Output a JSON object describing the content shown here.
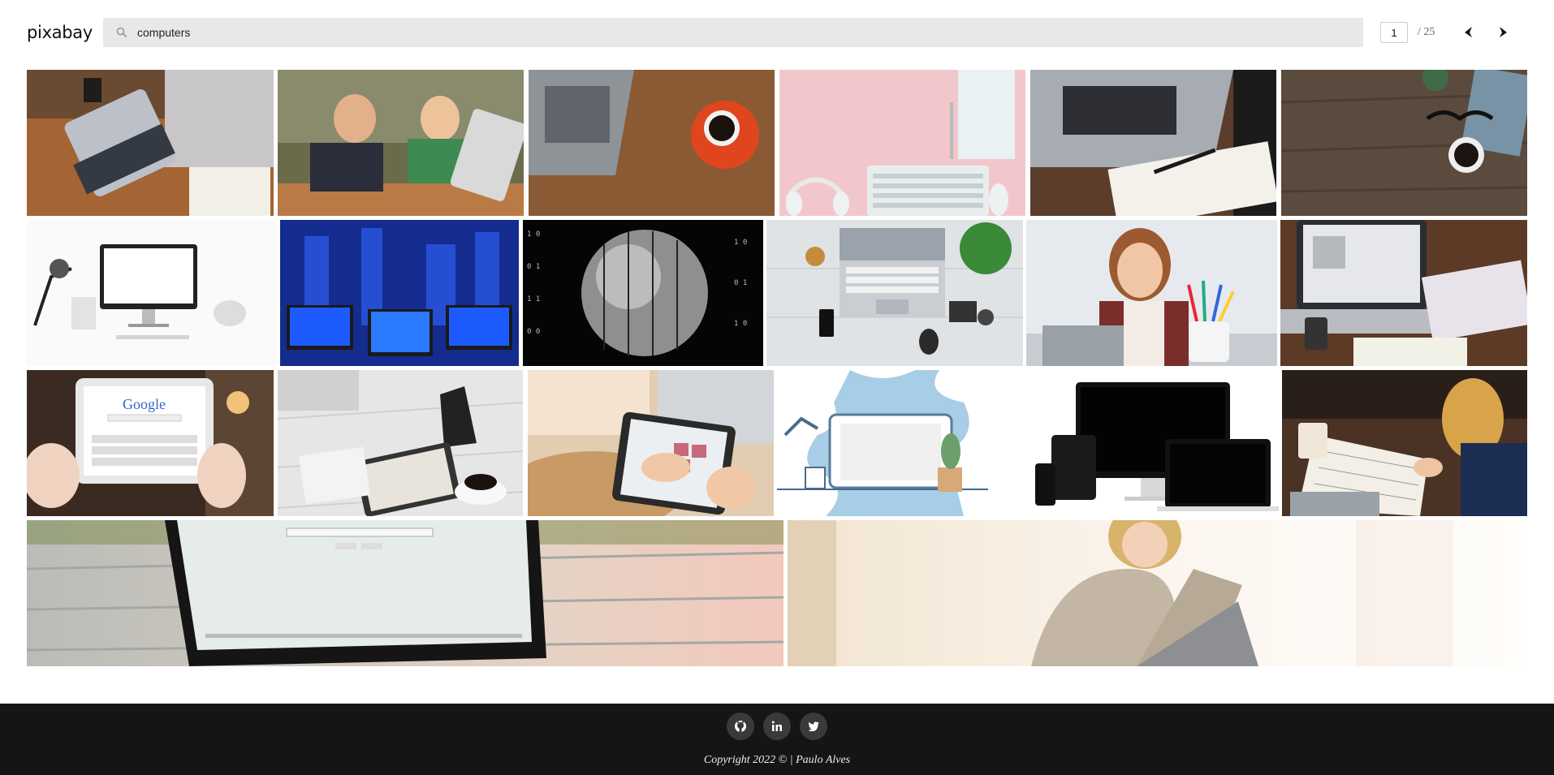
{
  "header": {
    "logo": "pixabay",
    "search": {
      "value": "computers",
      "icon": "search-icon"
    },
    "pager": {
      "current": "1",
      "total": "/ 25",
      "prev_icon": "chevron-left-icon",
      "next_icon": "chevron-right-icon"
    }
  },
  "gallery": {
    "rows": [
      {
        "images": [
          {
            "subject": "laptop-typing-icon"
          },
          {
            "subject": "kids-laptop-icon"
          },
          {
            "subject": "laptop-coffee-icon"
          },
          {
            "subject": "keyboard-headphones-icon"
          },
          {
            "subject": "laptop-notebook-icon"
          },
          {
            "subject": "desk-glasses-icon"
          }
        ]
      },
      {
        "images": [
          {
            "subject": "imac-desk-icon"
          },
          {
            "subject": "blue-monitors-icon"
          },
          {
            "subject": "binary-sphere-icon"
          },
          {
            "subject": "laptop-flatlay-icon"
          },
          {
            "subject": "woman-pencil-icon"
          },
          {
            "subject": "laptop-hands-icon"
          }
        ]
      },
      {
        "images": [
          {
            "subject": "tablet-google-icon"
          },
          {
            "subject": "tablet-coffee-icon"
          },
          {
            "subject": "tablet-hands-icon"
          },
          {
            "subject": "laptop-illustration-icon"
          },
          {
            "subject": "devices-icon"
          },
          {
            "subject": "notebook-people-icon"
          }
        ]
      },
      {
        "images": [
          {
            "subject": "macbook-search-icon"
          },
          {
            "subject": "woman-laptop-icon"
          }
        ]
      }
    ]
  },
  "footer": {
    "social": [
      {
        "name": "github-icon"
      },
      {
        "name": "linkedin-icon"
      },
      {
        "name": "twitter-icon"
      }
    ],
    "copyright": "Copyright 2022 © | Paulo Alves"
  }
}
